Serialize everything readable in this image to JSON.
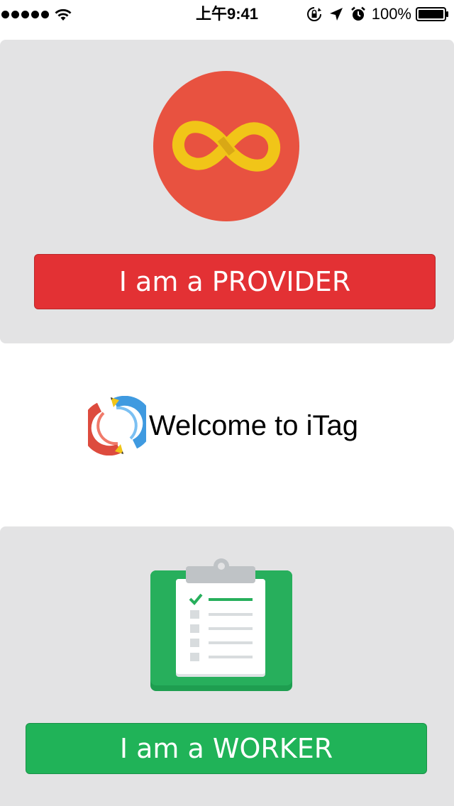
{
  "status_bar": {
    "time": "上午9:41",
    "battery": "100%"
  },
  "provider": {
    "button_label": "I am a PROVIDER",
    "button_color": "#e33134",
    "logo_icon": "infinity-icon"
  },
  "welcome": {
    "text": "Welcome to iTag",
    "logo_icon": "itag-logo"
  },
  "worker": {
    "button_label": "I am a WORKER",
    "button_color": "#20b358",
    "logo_icon": "clipboard-checklist-icon"
  },
  "colors": {
    "card_background": "#e3e3e4",
    "provider_red": "#e33134",
    "worker_green": "#20b358"
  }
}
